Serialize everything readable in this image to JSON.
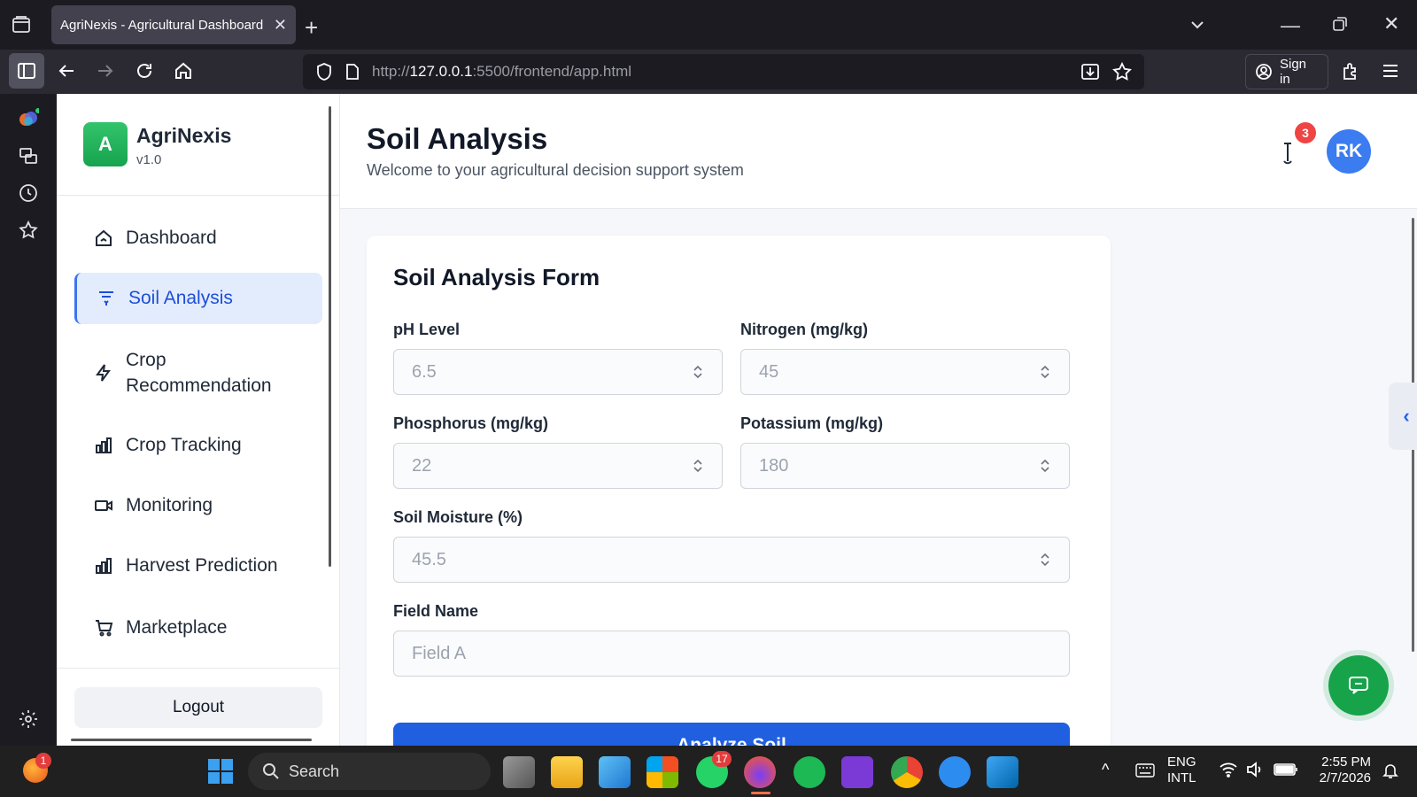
{
  "browser": {
    "tab_title": "AgriNexis - Agricultural Dashboard",
    "url_prefix": "http://",
    "url_host": "127.0.0.1",
    "url_rest": ":5500/frontend/app.html",
    "sign_in": "Sign in"
  },
  "sidebar": {
    "logo_letter": "A",
    "brand": "AgriNexis",
    "version": "v1.0",
    "items": [
      {
        "label": "Dashboard",
        "icon": "home-icon"
      },
      {
        "label": "Soil Analysis",
        "icon": "filter-icon",
        "active": true
      },
      {
        "label": "Crop Recommendation",
        "icon": "bolt-icon"
      },
      {
        "label": "Crop Tracking",
        "icon": "bar-chart-icon"
      },
      {
        "label": "Monitoring",
        "icon": "video-icon"
      },
      {
        "label": "Harvest Prediction",
        "icon": "bar-chart-icon"
      },
      {
        "label": "Marketplace",
        "icon": "cart-icon"
      }
    ],
    "logout": "Logout"
  },
  "header": {
    "title": "Soil Analysis",
    "subtitle": "Welcome to your agricultural decision support system",
    "notification_count": "3",
    "avatar_initials": "RK"
  },
  "form": {
    "title": "Soil Analysis Form",
    "ph_label": "pH Level",
    "ph_placeholder": "6.5",
    "nitrogen_label": "Nitrogen (mg/kg)",
    "nitrogen_placeholder": "45",
    "phosphorus_label": "Phosphorus (mg/kg)",
    "phosphorus_placeholder": "22",
    "potassium_label": "Potassium (mg/kg)",
    "potassium_placeholder": "180",
    "moisture_label": "Soil Moisture (%)",
    "moisture_placeholder": "45.5",
    "field_label": "Field Name",
    "field_placeholder": "Field A",
    "submit": "Analyze Soil"
  },
  "taskbar": {
    "search": "Search",
    "start_badge": "1",
    "whatsapp_badge": "17",
    "lang1": "ENG",
    "lang2": "INTL",
    "time": "2:55 PM",
    "date": "2/7/2026"
  },
  "colors": {
    "accent": "#1f5fe0",
    "brand_green": "#17a34f",
    "badge_red": "#ef4444"
  }
}
